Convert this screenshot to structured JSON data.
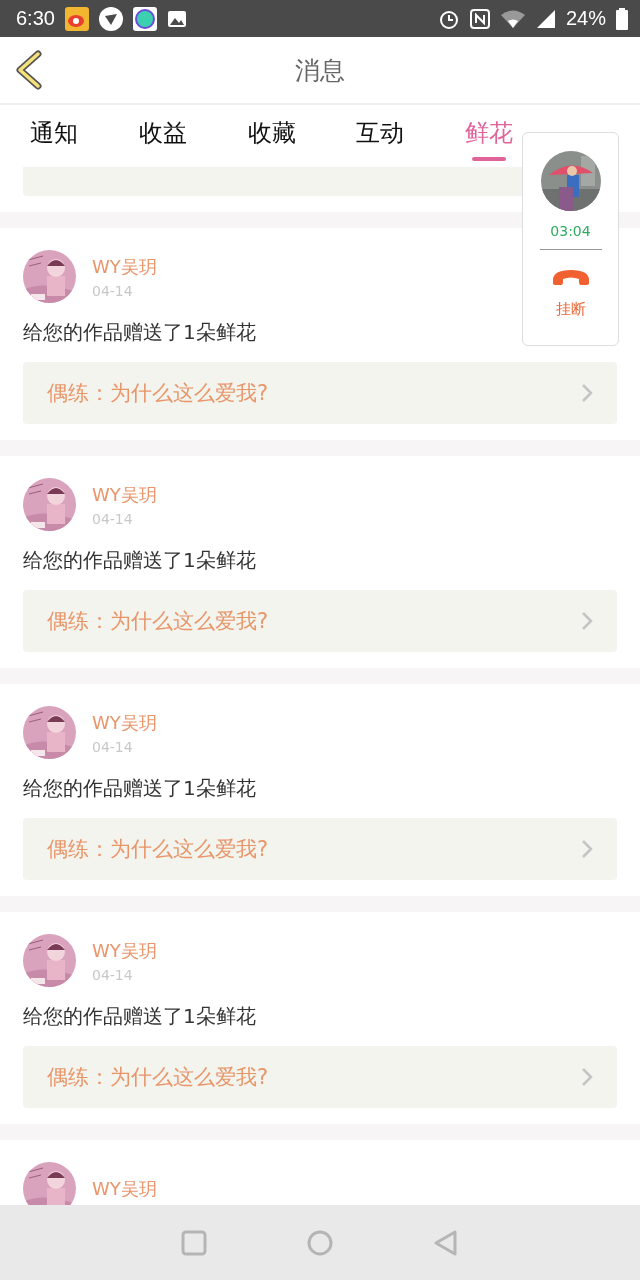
{
  "status_bar": {
    "time": "6:30",
    "battery": "24%"
  },
  "header": {
    "title": "消息"
  },
  "tabs": [
    {
      "label": "通知",
      "selected": false
    },
    {
      "label": "收益",
      "selected": false
    },
    {
      "label": "收藏",
      "selected": false
    },
    {
      "label": "互动",
      "selected": false
    },
    {
      "label": "鲜花",
      "selected": true
    }
  ],
  "items": [
    {
      "name": "WY吴玥",
      "date": "04-14",
      "message": "给您的作品赠送了1朵鲜花",
      "work": "偶练：为什么这么爱我?"
    },
    {
      "name": "WY吴玥",
      "date": "04-14",
      "message": "给您的作品赠送了1朵鲜花",
      "work": "偶练：为什么这么爱我?"
    },
    {
      "name": "WY吴玥",
      "date": "04-14",
      "message": "给您的作品赠送了1朵鲜花",
      "work": "偶练：为什么这么爱我?"
    },
    {
      "name": "WY吴玥",
      "date": "04-14",
      "message": "给您的作品赠送了1朵鲜花",
      "work": "偶练：为什么这么爱我?"
    },
    {
      "name": "WY吴玥"
    }
  ],
  "call": {
    "duration": "03:04",
    "hangup": "挂断"
  }
}
